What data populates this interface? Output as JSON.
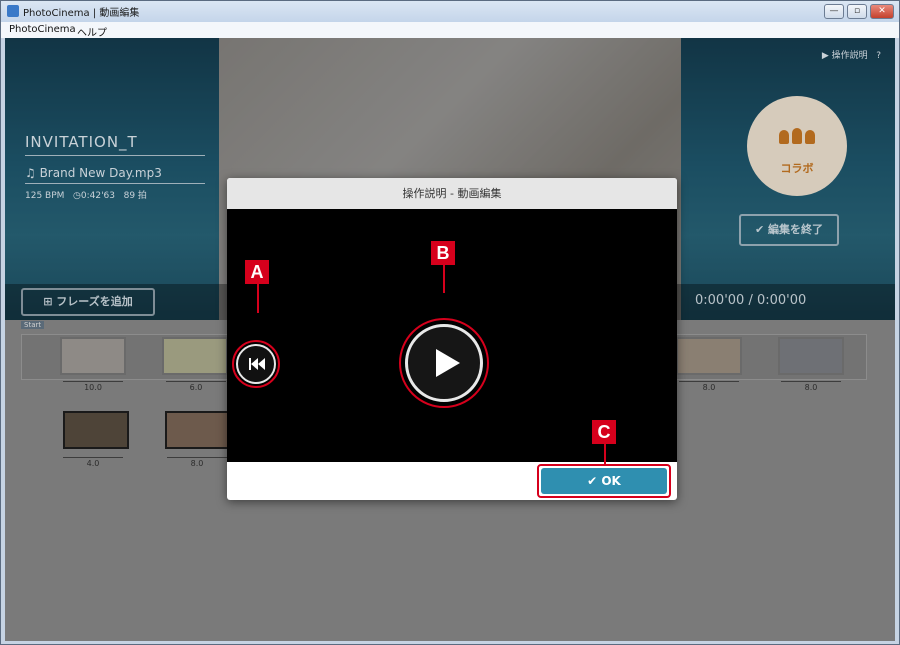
{
  "window": {
    "title": "PhotoCinema | 動画編集",
    "minimize": "—",
    "maximize": "▫",
    "close": "✕"
  },
  "menu": [
    "PhotoCinema",
    "ヘルプ"
  ],
  "project": {
    "title": "INVITATION_T",
    "music": "♫ Brand New Day.mp3",
    "bpm": "125 BPM",
    "duration": "0:42'63",
    "beats": "89 拍",
    "help_link": "操作説明",
    "help_q": "?"
  },
  "collab_label": "コラボ",
  "finish_label": "編集を終了",
  "add_phrase_label": "フレーズを追加",
  "timecode": "0:00'00 / 0:00'00",
  "timeline": {
    "start_label": "Start",
    "row1_durations": [
      "10.0",
      "6.0",
      "8.0",
      "8.0"
    ],
    "row2_durations": [
      "4.0",
      "8.0"
    ]
  },
  "dialog": {
    "title": "操作説明 - 動画編集",
    "ok_label": "OK"
  },
  "callouts": [
    "A",
    "B",
    "C"
  ],
  "colors": {
    "accent": "#2f8fb0",
    "callout_red": "#d6001c",
    "collab_brown": "#b26a1e"
  }
}
